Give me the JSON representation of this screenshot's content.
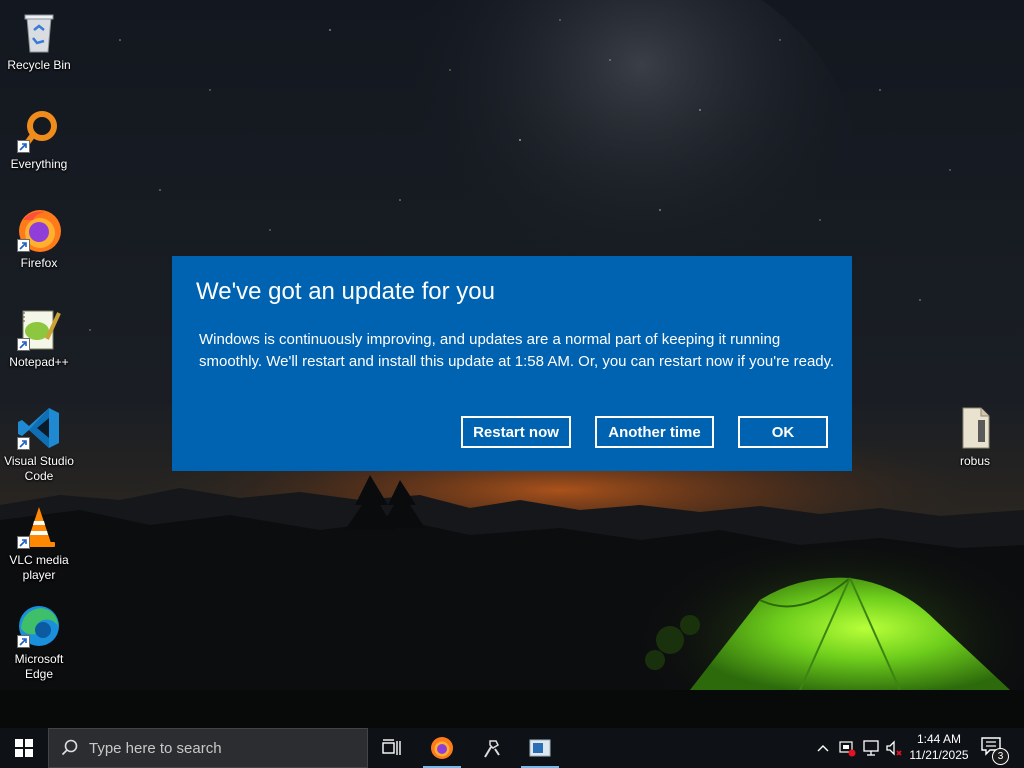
{
  "desktop": {
    "left_icons": [
      {
        "label": "Recycle Bin",
        "icon": "recycle-bin-icon"
      },
      {
        "label": "Everything",
        "icon": "everything-search-icon"
      },
      {
        "label": "Firefox",
        "icon": "firefox-icon"
      },
      {
        "label": "Notepad++",
        "icon": "notepad-plus-plus-icon"
      },
      {
        "label": "Visual Studio Code",
        "icon": "vscode-icon"
      },
      {
        "label": "VLC media player",
        "icon": "vlc-icon"
      },
      {
        "label": "Microsoft Edge",
        "icon": "edge-icon"
      }
    ],
    "right_icons": [
      {
        "label": "robus",
        "icon": "file-icon"
      }
    ]
  },
  "dialog": {
    "title": "We've got an update for you",
    "body": "Windows is continuously improving, and updates are a normal part of keeping it running smoothly. We'll restart and install this update at 1:58 AM. Or, you can restart now if you're ready.",
    "buttons": {
      "restart": "Restart now",
      "another": "Another time",
      "ok": "OK"
    },
    "background_color": "#0063b1"
  },
  "taskbar": {
    "search_placeholder": "Type here to search",
    "pinned": [
      {
        "name": "task-view",
        "icon": "task-view-icon"
      },
      {
        "name": "firefox",
        "icon": "firefox-icon"
      },
      {
        "name": "tool",
        "icon": "paint-tool-icon"
      },
      {
        "name": "window",
        "icon": "window-app-icon"
      }
    ],
    "time": "1:44 AM",
    "date": "11/21/2025",
    "notification_count": "3"
  }
}
